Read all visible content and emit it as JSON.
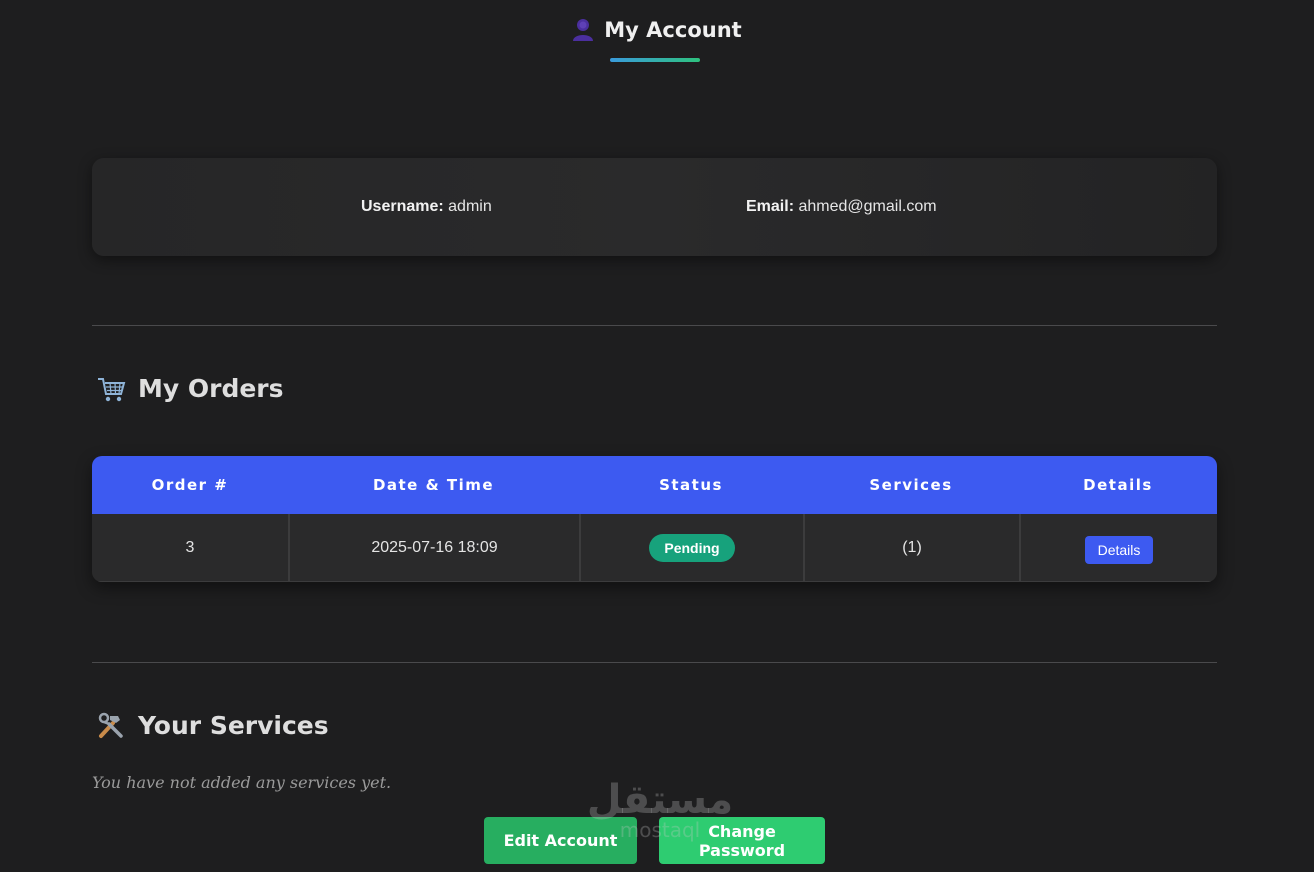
{
  "header": {
    "title": "My Account",
    "icon": "user-icon",
    "underline_colors": [
      "#3a9bdc",
      "#2ec27e"
    ]
  },
  "account": {
    "username_label": "Username:",
    "username_value": "admin",
    "email_label": "Email:",
    "email_value": "ahmed@gmail.com"
  },
  "orders": {
    "title": "My Orders",
    "icon": "shopping-cart-icon",
    "columns": [
      "Order #",
      "Date & Time",
      "Status",
      "Services",
      "Details"
    ],
    "rows": [
      {
        "order_no": "3",
        "datetime": "2025-07-16 18:09",
        "status": "Pending",
        "services": "(1)",
        "details_label": "Details"
      }
    ]
  },
  "services": {
    "title": "Your Services",
    "icon": "tools-icon",
    "empty_message": "You have not added any services yet."
  },
  "actions": {
    "edit_label": "Edit Account",
    "password_label": "Change Password"
  },
  "watermark": {
    "arabic": "مستقل",
    "latin": "mostaql"
  },
  "colors": {
    "background": "#1e1e1f",
    "accent_blue": "#3d5af1",
    "badge_pending": "#17a27c",
    "btn_edit": "#27ae60",
    "btn_password": "#2ecc71"
  }
}
